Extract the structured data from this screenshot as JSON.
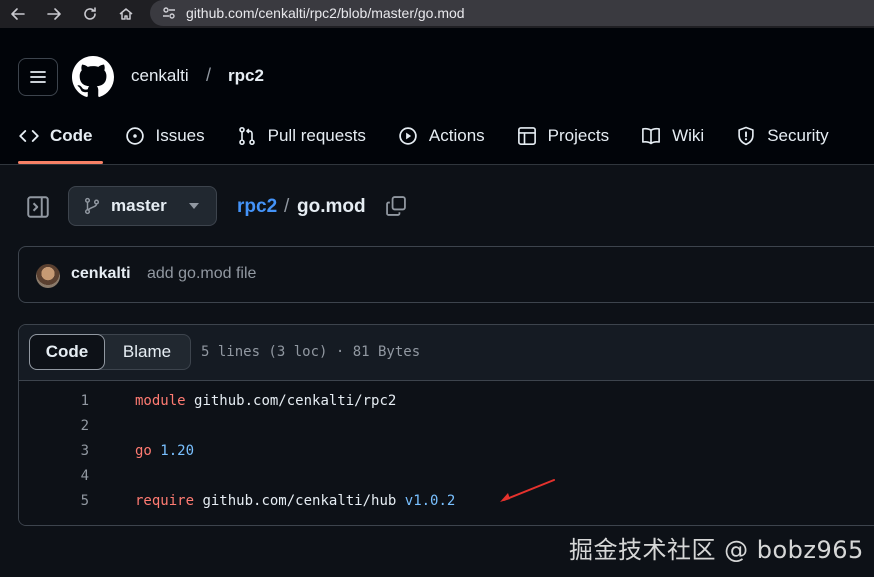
{
  "browser": {
    "url": "github.com/cenkalti/rpc2/blob/master/go.mod"
  },
  "header": {
    "owner": "cenkalti",
    "separator": "/",
    "repo": "rpc2",
    "tabs": [
      {
        "label": "Code",
        "icon": "code-icon",
        "active": true
      },
      {
        "label": "Issues",
        "icon": "issue-icon"
      },
      {
        "label": "Pull requests",
        "icon": "pull-request-icon"
      },
      {
        "label": "Actions",
        "icon": "play-icon"
      },
      {
        "label": "Projects",
        "icon": "table-icon"
      },
      {
        "label": "Wiki",
        "icon": "book-icon"
      },
      {
        "label": "Security",
        "icon": "shield-icon"
      }
    ]
  },
  "file": {
    "branch": "master",
    "breadcrumb_repo": "rpc2",
    "breadcrumb_sep": "/",
    "filename": "go.mod"
  },
  "commit": {
    "author": "cenkalti",
    "message": "add go.mod file"
  },
  "viewer": {
    "code_tab": "Code",
    "blame_tab": "Blame",
    "meta": "5 lines (3 loc) · 81 Bytes"
  },
  "code_lines": [
    {
      "num": "1",
      "keyword": "module",
      "path": "github.com/cenkalti/rpc2",
      "version": ""
    },
    {
      "num": "2",
      "keyword": "",
      "path": "",
      "version": ""
    },
    {
      "num": "3",
      "keyword": "go",
      "path": "",
      "version": "1.20"
    },
    {
      "num": "4",
      "keyword": "",
      "path": "",
      "version": ""
    },
    {
      "num": "5",
      "keyword": "require",
      "path": "github.com/cenkalti/hub",
      "version": "v1.0.2"
    }
  ],
  "colors": {
    "accent": "#f78166",
    "link": "#4493f8",
    "keyword": "#ff7b72",
    "constant": "#79c0ff",
    "annotation_arrow": "#e5322d"
  },
  "watermark": "掘金技术社区 @ bobz965"
}
